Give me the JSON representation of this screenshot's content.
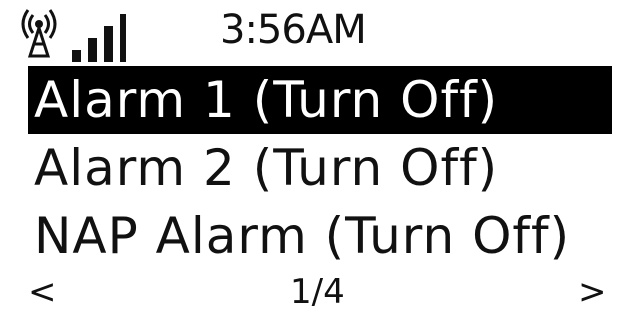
{
  "status": {
    "time": "3:56AM",
    "antenna_icon": "antenna-icon",
    "signal_icon": "signal-strength-icon"
  },
  "menu": {
    "items": [
      {
        "label": "Alarm 1 (Turn Off)",
        "selected": true
      },
      {
        "label": "Alarm 2 (Turn Off)",
        "selected": false
      },
      {
        "label": "NAP Alarm (Turn Off)",
        "selected": false
      }
    ]
  },
  "footer": {
    "prev": "<",
    "page": "1/4",
    "next": ">"
  },
  "colors": {
    "background": "#ffffff",
    "text": "#111111",
    "highlight": "#000000",
    "highlight_text": "#ffffff"
  }
}
